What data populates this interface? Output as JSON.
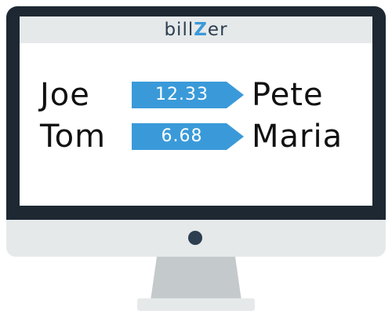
{
  "app": {
    "brand_prefix": "bill",
    "brand_accent": "Z",
    "brand_suffix": "er"
  },
  "transfers": [
    {
      "from": "Joe",
      "amount": "12.33",
      "to": "Pete"
    },
    {
      "from": "Tom",
      "amount": "6.68",
      "to": "Maria"
    }
  ],
  "colors": {
    "bezel": "#1d2832",
    "screen_titlebar": "#e6e9ea",
    "accent": "#3a9ad9",
    "stand": "#c9ced1"
  }
}
